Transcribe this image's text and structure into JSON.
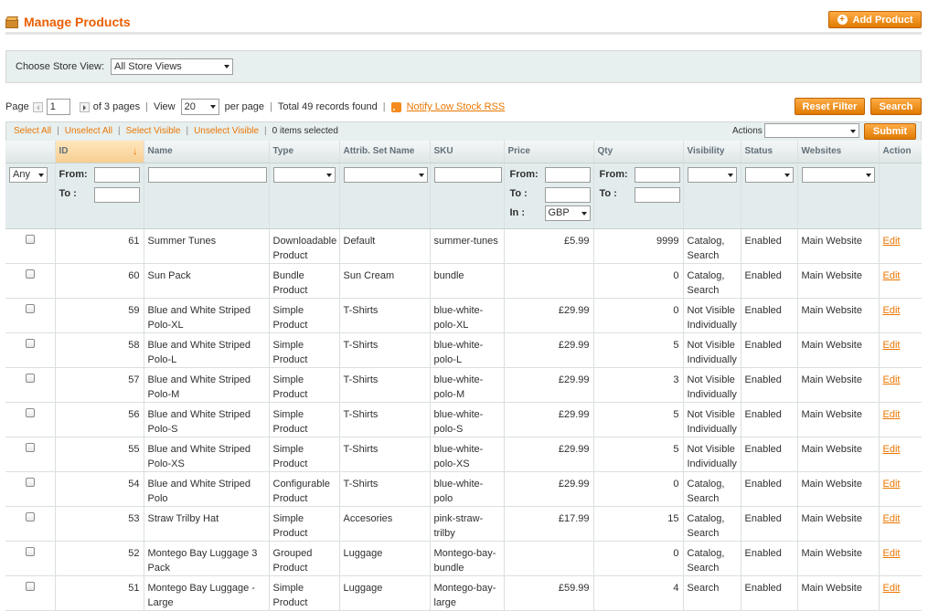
{
  "header": {
    "title": "Manage Products",
    "add_button": "Add Product"
  },
  "store": {
    "label": "Choose Store View:",
    "selected": "All Store Views"
  },
  "pager": {
    "page_label": "Page",
    "page_value": "1",
    "of_pages": "of 3 pages",
    "view_label": "View",
    "view_value": "20",
    "per_page": "per page",
    "total": "Total 49 records found",
    "rss_link": "Notify Low Stock RSS",
    "reset_button": "Reset Filter",
    "search_button": "Search"
  },
  "massaction": {
    "select_all": "Select All",
    "unselect_all": "Unselect All",
    "select_visible": "Select Visible",
    "unselect_visible": "Unselect Visible",
    "selected_count": "0 items selected",
    "actions_label": "Actions",
    "submit": "Submit"
  },
  "columns": {
    "id": "ID",
    "name": "Name",
    "type": "Type",
    "attrib_set": "Attrib. Set Name",
    "sku": "SKU",
    "price": "Price",
    "qty": "Qty",
    "visibility": "Visibility",
    "status": "Status",
    "websites": "Websites",
    "action": "Action"
  },
  "filters": {
    "any": "Any",
    "from": "From:",
    "to": "To :",
    "in": "In :",
    "currency": "GBP"
  },
  "rows": [
    {
      "id": "61",
      "name": "Summer Tunes",
      "type": "Downloadable Product",
      "set": "Default",
      "sku": "summer-tunes",
      "price": "£5.99",
      "qty": "9999",
      "visibility": "Catalog, Search",
      "status": "Enabled",
      "websites": "Main Website",
      "action": "Edit"
    },
    {
      "id": "60",
      "name": "Sun Pack",
      "type": "Bundle Product",
      "set": "Sun Cream",
      "sku": "bundle",
      "price": "",
      "qty": "0",
      "visibility": "Catalog, Search",
      "status": "Enabled",
      "websites": "Main Website",
      "action": "Edit"
    },
    {
      "id": "59",
      "name": "Blue and White Striped Polo-XL",
      "type": "Simple Product",
      "set": "T-Shirts",
      "sku": "blue-white-polo-XL",
      "price": "£29.99",
      "qty": "0",
      "visibility": "Not Visible Individually",
      "status": "Enabled",
      "websites": "Main Website",
      "action": "Edit"
    },
    {
      "id": "58",
      "name": "Blue and White Striped Polo-L",
      "type": "Simple Product",
      "set": "T-Shirts",
      "sku": "blue-white-polo-L",
      "price": "£29.99",
      "qty": "5",
      "visibility": "Not Visible Individually",
      "status": "Enabled",
      "websites": "Main Website",
      "action": "Edit"
    },
    {
      "id": "57",
      "name": "Blue and White Striped Polo-M",
      "type": "Simple Product",
      "set": "T-Shirts",
      "sku": "blue-white-polo-M",
      "price": "£29.99",
      "qty": "3",
      "visibility": "Not Visible Individually",
      "status": "Enabled",
      "websites": "Main Website",
      "action": "Edit"
    },
    {
      "id": "56",
      "name": "Blue and White Striped Polo-S",
      "type": "Simple Product",
      "set": "T-Shirts",
      "sku": "blue-white-polo-S",
      "price": "£29.99",
      "qty": "5",
      "visibility": "Not Visible Individually",
      "status": "Enabled",
      "websites": "Main Website",
      "action": "Edit"
    },
    {
      "id": "55",
      "name": "Blue and White Striped Polo-XS",
      "type": "Simple Product",
      "set": "T-Shirts",
      "sku": "blue-white-polo-XS",
      "price": "£29.99",
      "qty": "5",
      "visibility": "Not Visible Individually",
      "status": "Enabled",
      "websites": "Main Website",
      "action": "Edit"
    },
    {
      "id": "54",
      "name": "Blue and White Striped Polo",
      "type": "Configurable Product",
      "set": "T-Shirts",
      "sku": "blue-white-polo",
      "price": "£29.99",
      "qty": "0",
      "visibility": "Catalog, Search",
      "status": "Enabled",
      "websites": "Main Website",
      "action": "Edit"
    },
    {
      "id": "53",
      "name": "Straw Trilby Hat",
      "type": "Simple Product",
      "set": "Accesories",
      "sku": "pink-straw-trilby",
      "price": "£17.99",
      "qty": "15",
      "visibility": "Catalog, Search",
      "status": "Enabled",
      "websites": "Main Website",
      "action": "Edit"
    },
    {
      "id": "52",
      "name": "Montego Bay Luggage 3 Pack",
      "type": "Grouped Product",
      "set": "Luggage",
      "sku": "Montego-bay-bundle",
      "price": "",
      "qty": "0",
      "visibility": "Catalog, Search",
      "status": "Enabled",
      "websites": "Main Website",
      "action": "Edit"
    },
    {
      "id": "51",
      "name": "Montego Bay Luggage - Large",
      "type": "Simple Product",
      "set": "Luggage",
      "sku": "Montego-bay-large",
      "price": "£59.99",
      "qty": "4",
      "visibility": "Search",
      "status": "Enabled",
      "websites": "Main Website",
      "action": "Edit"
    }
  ],
  "colors": {
    "accent": "#eb5e00",
    "button": "#df7b00",
    "panel": "#e7efef"
  }
}
